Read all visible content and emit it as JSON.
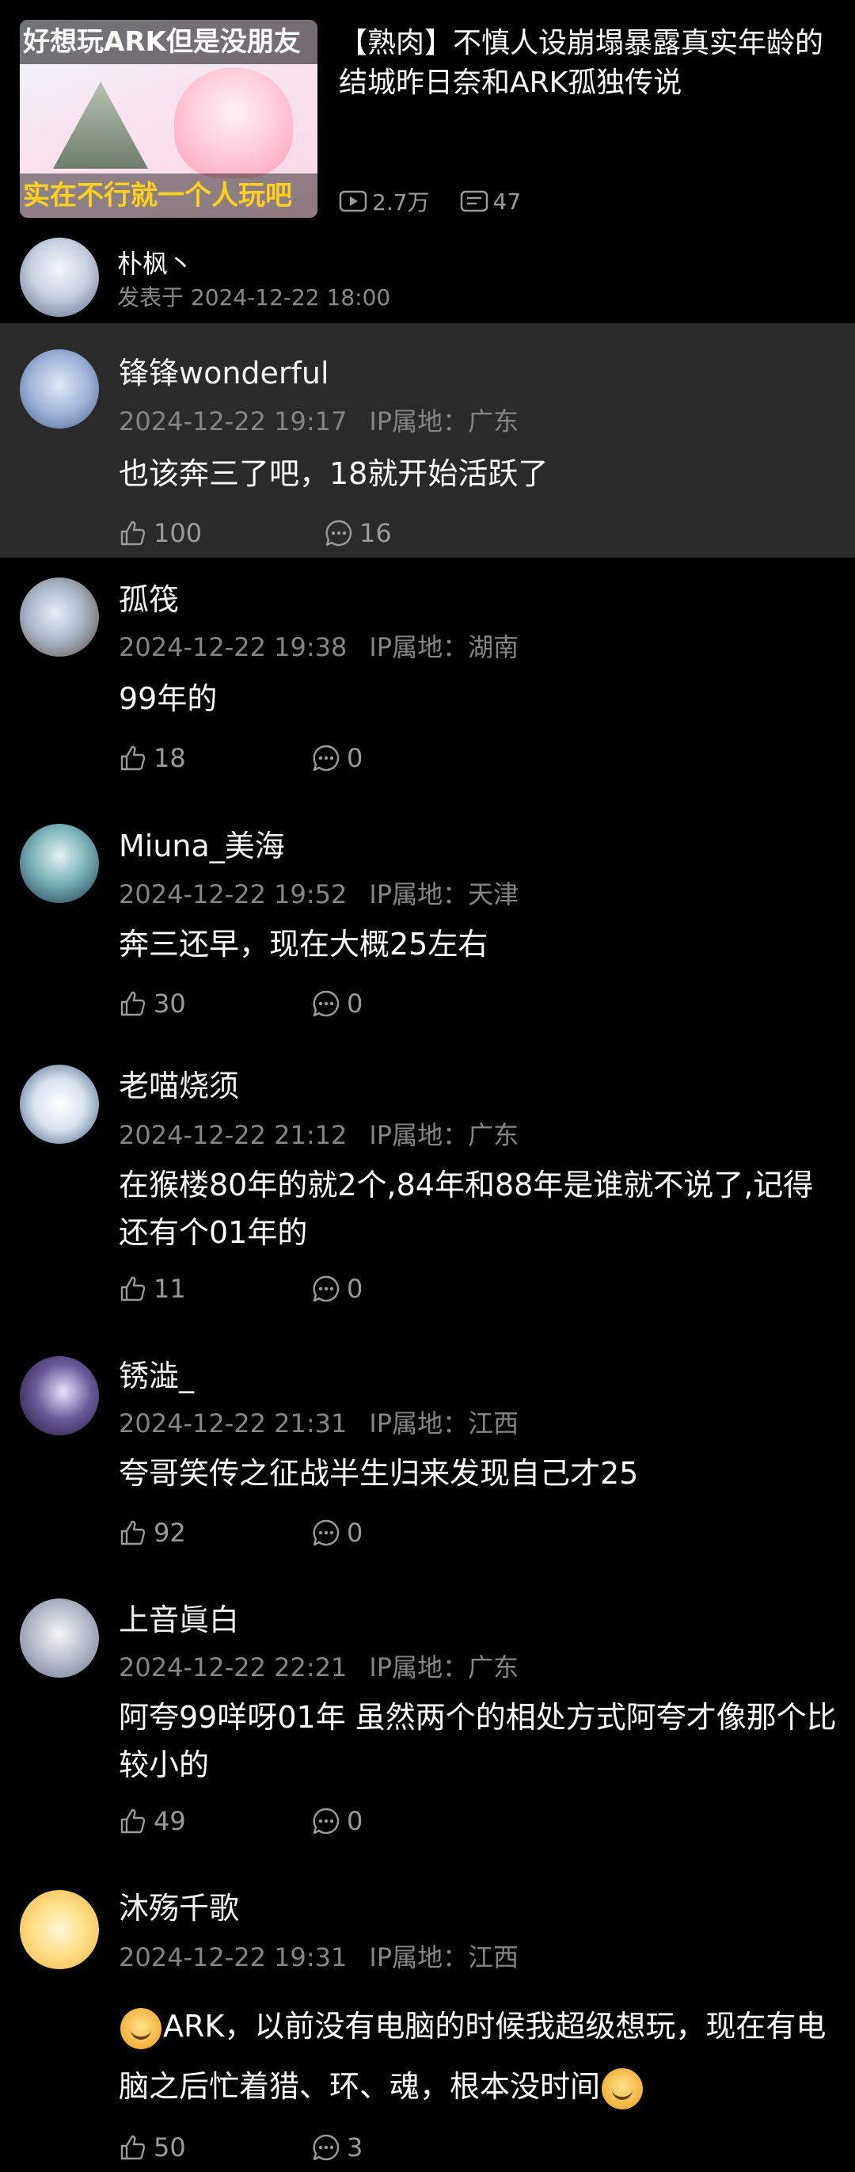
{
  "video": {
    "thumb_top_text": "好想玩ARK但是没朋友",
    "thumb_bottom_text": "实在不行就一个人玩吧",
    "title": "【熟肉】不慎人设崩塌暴露真实年龄的结城昨日奈和ARK孤独传说",
    "views": "2.7万",
    "comments": "47"
  },
  "post": {
    "author": "朴枫丶",
    "time": "发表于 2024-12-22 18:00"
  },
  "ip_label": "IP属地：",
  "comments": [
    {
      "user": "锋锋wonderful",
      "date": "2024-12-22 19:17",
      "ip": "广东",
      "text": "也该奔三了吧，18就开始活跃了",
      "likes": "100",
      "replies": "16"
    },
    {
      "user": "孤筏",
      "date": "2024-12-22 19:38",
      "ip": "湖南",
      "text": "99年的",
      "likes": "18",
      "replies": "0"
    },
    {
      "user": "Miuna_美海",
      "date": "2024-12-22 19:52",
      "ip": "天津",
      "text": "奔三还早，现在大概25左右",
      "likes": "30",
      "replies": "0"
    },
    {
      "user": "老喵烧须",
      "date": "2024-12-22 21:12",
      "ip": "广东",
      "text": "在猴楼80年的就2个,84年和88年是谁就不说了,记得还有个01年的",
      "likes": "11",
      "replies": "0"
    },
    {
      "user": "锈澁_",
      "date": "2024-12-22 21:31",
      "ip": "江西",
      "text": "夸哥笑传之征战半生归来发现自己才25",
      "likes": "92",
      "replies": "0"
    },
    {
      "user": "上音眞白",
      "date": "2024-12-22 22:21",
      "ip": "广东",
      "text": "阿夸99咩呀01年 虽然两个的相处方式阿夸才像那个比较小的",
      "likes": "49",
      "replies": "0"
    },
    {
      "user": "沐殇千歌",
      "date": "2024-12-22 19:31",
      "ip": "江西",
      "text": "ARK，以前没有电脑的时候我超级想玩，现在有电脑之后忙着猎、环、魂，根本没时间",
      "likes": "50",
      "replies": "3"
    }
  ],
  "colors": {
    "background": "#000000",
    "highlight_row": "#2a2a2a",
    "meta_text": "#858585",
    "thumb_yellow_text": "#ffd21a"
  }
}
